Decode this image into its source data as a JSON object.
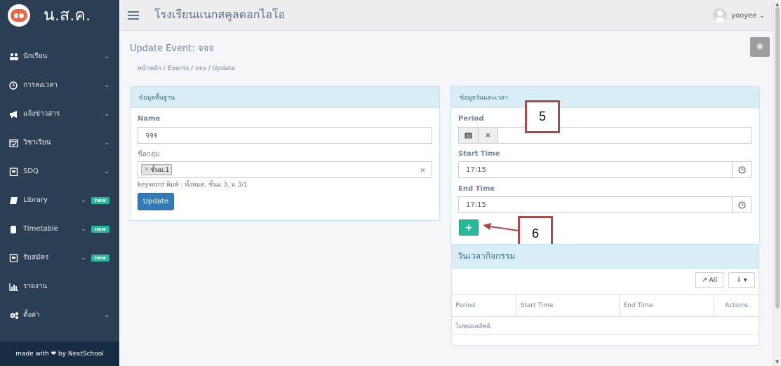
{
  "brand": {
    "name": "น.ส.ค."
  },
  "sidebar": {
    "items": [
      {
        "label": "นักเรียน",
        "icon": "users-icon",
        "chevron": "⌄",
        "badge": ""
      },
      {
        "label": "การลงเวลา",
        "icon": "clock-icon",
        "chevron": "⌄",
        "badge": ""
      },
      {
        "label": "แจ้งข่าวสาร",
        "icon": "bullhorn-icon",
        "chevron": "⌄",
        "badge": ""
      },
      {
        "label": "วิชาเรียน",
        "icon": "calendar-check-icon",
        "chevron": "⌄",
        "badge": ""
      },
      {
        "label": "SDQ",
        "icon": "clipboard-icon",
        "chevron": "⌄",
        "badge": ""
      },
      {
        "label": "Library",
        "icon": "book-icon",
        "chevron": "⌄",
        "badge": "new"
      },
      {
        "label": "Timetable",
        "icon": "database-icon",
        "chevron": "⌄",
        "badge": "new"
      },
      {
        "label": "รับสมัคร",
        "icon": "clipboard-icon",
        "chevron": "⌄",
        "badge": "new"
      },
      {
        "label": "รายงาน",
        "icon": "bar-chart-icon",
        "chevron": "",
        "badge": ""
      },
      {
        "label": "ตั้งค่า",
        "icon": "cogs-icon",
        "chevron": "⌄",
        "badge": ""
      }
    ],
    "footer": "made with ❤ by NextSchool"
  },
  "topbar": {
    "school_name": "โรงเรียนแนกสคูลดอกไอโอ",
    "user": "yooyee ⌄"
  },
  "page": {
    "title": "Update Event: จจจ",
    "breadcrumb": "หน้าหลัก  /  Events  /  จจจ  /  Update"
  },
  "basic_panel": {
    "heading": "ข้อมูลพื้นฐาน",
    "name_label": "Name",
    "name_value": "จจจ",
    "group_label": "ชื่อกลุ่ม",
    "group_tag": "ชั้นม.1",
    "group_tag_remove": "×",
    "group_clear": "×",
    "help_text": "keyword พิมพ์ : ทั้งหมด, ชั้นม.3, ม.3/1",
    "update_button": "Update"
  },
  "datetime_panel": {
    "heading": "ข้อมูลวันและเวลา",
    "period_label": "Period",
    "period_value": "",
    "period_calendar_icon": "calendar-icon",
    "period_clear": "×",
    "start_label": "Start Time",
    "start_value": "17:15",
    "end_label": "End Time",
    "end_value": "17:15",
    "time_icon": "clock-icon",
    "add_button": "+"
  },
  "annotations": {
    "box5": "5",
    "box6": "6"
  },
  "activity": {
    "heading": "วันเวลากิจกรรม",
    "all_button": "↗ All",
    "export_button": "⇩ ▾",
    "columns": [
      "Period",
      "Start Time",
      "End Time",
      "Actions"
    ],
    "empty_text": "ไม่พบผลลัพธ์"
  },
  "colors": {
    "sidebar": "#2a3f54",
    "accent": "#26b99a",
    "primary": "#337ab7",
    "panel_head": "#d9edf7",
    "annotation": "#a94a4a"
  }
}
